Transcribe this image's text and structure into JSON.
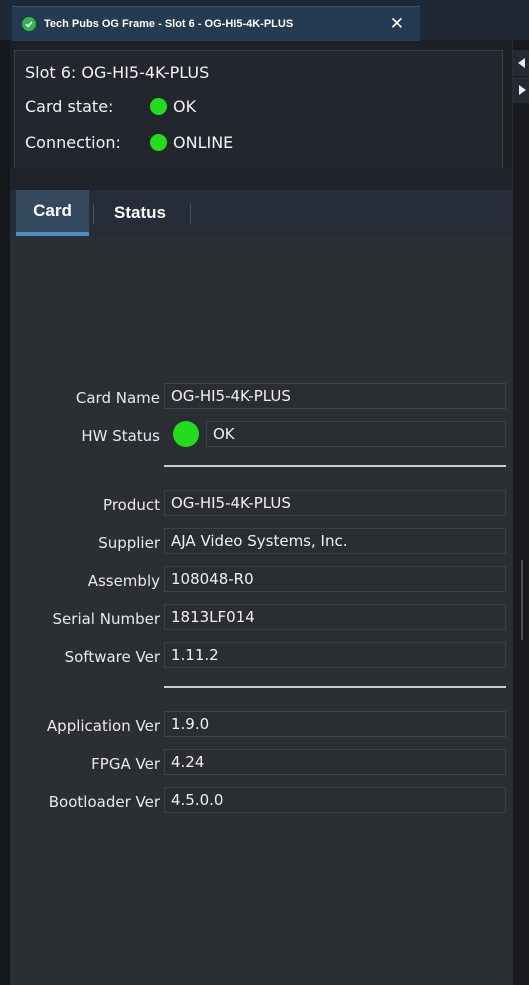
{
  "window": {
    "tab_title": "Tech Pubs OG Frame - Slot 6 - OG-HI5-4K-PLUS",
    "close_glyph": "✕"
  },
  "info": {
    "slot": "Slot 6: OG-HI5-4K-PLUS",
    "card_state_label": "Card state:",
    "card_state_value": "OK",
    "connection_label": "Connection:",
    "connection_value": "ONLINE",
    "status_color": "#22dd1c"
  },
  "tabs": [
    {
      "label": "Card",
      "active": true
    },
    {
      "label": "Status",
      "active": false
    }
  ],
  "fields": {
    "card_name": {
      "label": "Card Name",
      "value": "OG-HI5-4K-PLUS"
    },
    "hw_status": {
      "label": "HW Status",
      "value": "OK"
    },
    "product": {
      "label": "Product",
      "value": "OG-HI5-4K-PLUS"
    },
    "supplier": {
      "label": "Supplier",
      "value": "AJA Video Systems, Inc."
    },
    "assembly": {
      "label": "Assembly",
      "value": "108048-R0"
    },
    "serial": {
      "label": "Serial Number",
      "value": "1813LF014"
    },
    "software": {
      "label": "Software Ver",
      "value": "1.11.2"
    },
    "application": {
      "label": "Application Ver",
      "value": "1.9.0"
    },
    "fpga": {
      "label": "FPGA Ver",
      "value": "4.24"
    },
    "bootloader": {
      "label": "Bootloader Ver",
      "value": "4.5.0.0"
    }
  },
  "icons": {
    "tab_status": "check-circle-icon",
    "collapse_left": "triangle-left-icon",
    "expand_right": "triangle-right-icon"
  }
}
